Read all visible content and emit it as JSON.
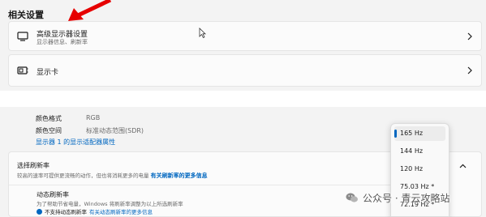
{
  "related": {
    "heading": "相关设置",
    "advanced": {
      "title": "高级显示器设置",
      "subtitle": "显示器信息、刷新率"
    },
    "gpu": {
      "title": "显示卡"
    }
  },
  "display_info": {
    "color_format_label": "颜色格式",
    "color_format_value": "RGB",
    "color_space_label": "颜色空间",
    "color_space_value": "标准动态范围(SDR)",
    "adapter_link": "显示器 1 的显示适配器属性"
  },
  "refresh": {
    "title": "选择刷新率",
    "description": "较高的速率可提供更流畅的动作，但也将消耗更多的电量",
    "description_link": "有关刷新率的更多信息",
    "dynamic_title": "动态刷新率",
    "dynamic_description": "为了帮助节省电量，Windows 将刷新率调整为以上所选刷新率",
    "dynamic_warning": "不支持动态刷新率",
    "dynamic_warning_link": "有关动态刷新率的更多信息"
  },
  "refresh_dropdown": {
    "options": [
      "165 Hz",
      "144 Hz",
      "120 Hz",
      "75.03 Hz *",
      "72.19 Hz *"
    ],
    "selected_index": 0
  },
  "watermark": {
    "text": "公众号 · 青云攻略站"
  },
  "icons": {
    "monitor": "monitor-icon",
    "gpu": "gpu-icon",
    "chevron": "chevron-right-icon",
    "collapse": "chevron-up-icon",
    "wechat": "wechat-icon"
  },
  "colors": {
    "accent": "#0067c0",
    "annotation_arrow": "#e60000"
  }
}
